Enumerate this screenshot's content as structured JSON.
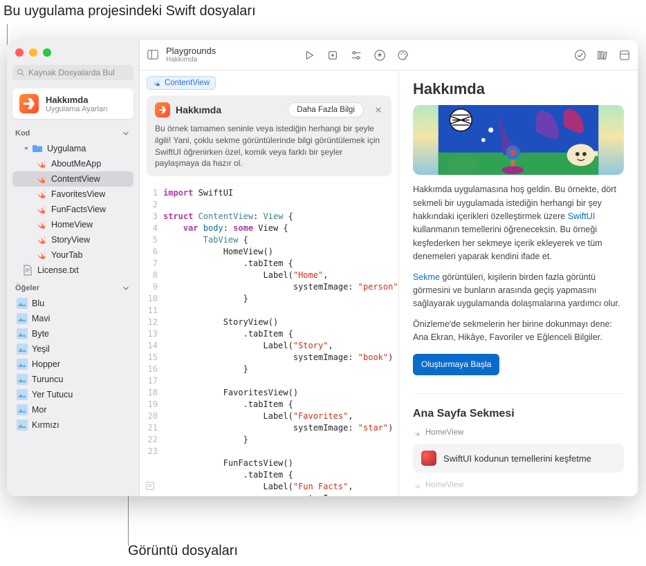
{
  "callout_top": "Bu uygulama projesindeki Swift dosyaları",
  "callout_bottom": "Görüntü dosyaları",
  "toolbar": {
    "title": "Playgrounds",
    "subtitle": "Hakkımda"
  },
  "sidebar": {
    "search_placeholder": "Kaynak Dosyalarda Bul",
    "app_title": "Hakkımda",
    "app_sub": "Uygulama Ayarları",
    "sec_code": "Kod",
    "folder": "Uygulama",
    "files": [
      "AboutMeApp",
      "ContentView",
      "FavoritesView",
      "FunFactsView",
      "HomeView",
      "StoryView",
      "YourTab"
    ],
    "license": "License.txt",
    "sec_assets": "Öğeler",
    "assets": [
      "Blu",
      "Mavi",
      "Byte",
      "Yeşil",
      "Hopper",
      "Turuncu",
      "Yer Tutucu",
      "Mor",
      "Kırmızı"
    ]
  },
  "crumb": "ContentView",
  "info": {
    "title": "Hakkımda",
    "more": "Daha Fazla Bilgi",
    "body": "Bu örnek tamamen seninle veya istediğin herhangi bir şeyle ilgili! Yani, çoklu sekme görüntülerinde bilgi görüntülemek için SwiftUI öğrenirken özel, komik veya farklı bir şeyler paylaşmaya da hazır ol."
  },
  "code": {
    "lines": 23,
    "l1": "import",
    "l1b": " SwiftUI",
    "l3a": "struct ",
    "l3b": "ContentView",
    "l3c": ": ",
    "l3d": "View",
    "l3e": " {",
    "l4a": "    var ",
    "l4b": "body",
    "l4c": ": ",
    "l4d": "some",
    "l4e": " View {",
    "l5a": "        TabView",
    "l5b": " {",
    "l6": "            HomeView()",
    "l7": "                .tabItem {",
    "l8a": "                    Label(",
    "l8b": "\"Home\"",
    "l8c": ",",
    "l8d": "                          systemImage: ",
    "l8e": "\"person\"",
    "l8f": ")",
    "l9": "                }",
    "l11": "            StoryView()",
    "l12": "                .tabItem {",
    "l13a": "                    Label(",
    "l13b": "\"Story\"",
    "l13c": ",",
    "l13d": "                          systemImage: ",
    "l13e": "\"book\"",
    "l13f": ")",
    "l14": "                }",
    "l16": "            FavoritesView()",
    "l17": "                .tabItem {",
    "l18a": "                    Label(",
    "l18b": "\"Favorites\"",
    "l18c": ",",
    "l18d": "                          systemImage: ",
    "l18e": "\"star\"",
    "l18f": ")",
    "l19": "                }",
    "l21": "            FunFactsView()",
    "l22": "                .tabItem {",
    "l23a": "                    Label(",
    "l23b": "\"Fun Facts\"",
    "l23c": ",",
    "l23d": "                          systemImage:"
  },
  "preview": {
    "title": "Hakkımda",
    "p1a": "Hakkımda uygulamasına hoş geldin. Bu örnekte, dört sekmeli bir uygulamada istediğin herhangi bir şey hakkındaki içerikleri özelleştirmek üzere ",
    "p1link": "SwiftUI",
    "p1b": " kullanmanın temellerini öğreneceksin. Bu örneği keşfederken her sekmeye içerik ekleyerek ve tüm denemeleri yaparak kendini ifade et.",
    "p2link": "Sekme",
    "p2": " görüntüleri, kişilerin birden fazla görüntü görmesini ve bunların arasında geçiş yapmasını sağlayarak uygulamanda dolaşmalarına yardımcı olur.",
    "p3": "Önizleme'de sekmelerin her birine dokunmayı dene: Ana Ekran, Hikâye, Favoriler ve Eğlenceli Bilgiler.",
    "cta": "Oluşturmaya Başla",
    "sec2_title": "Ana Sayfa Sekmesi",
    "link_hv": "HomeView",
    "lesson": "SwiftUI kodunun temellerini keşfetme",
    "link_hv2": "HomeView"
  }
}
